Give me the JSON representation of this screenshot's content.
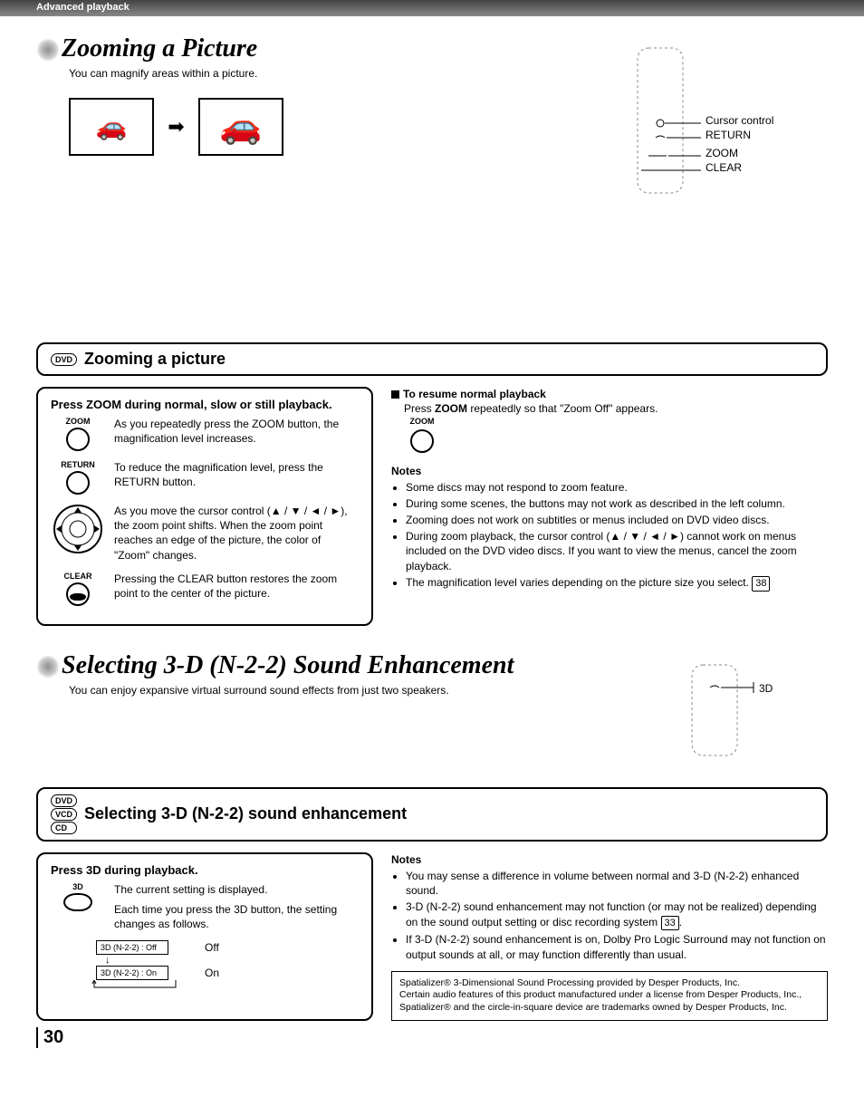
{
  "topbar": "Advanced playback",
  "zoom": {
    "title": "Zooming a Picture",
    "subtitle": "You can magnify areas within a picture.",
    "remote_labels": {
      "cursor": "Cursor control",
      "return": "RETURN",
      "zoom": "ZOOM",
      "clear": "CLEAR"
    },
    "bar_label": "Zooming a picture",
    "bar_badge": "DVD",
    "instruction_head": "Press ZOOM during normal, slow or still playback.",
    "btn_zoom": "ZOOM",
    "btn_return": "RETURN",
    "btn_clear": "CLEAR",
    "txt_zoom": "As you repeatedly press the ZOOM button, the magnification level increases.",
    "txt_return": "To reduce the magnification level, press the RETURN button.",
    "txt_cursor": "As you move the cursor control (▲ / ▼ / ◄ / ►), the zoom point shifts. When the zoom point reaches an edge of the picture, the color of \"Zoom\" changes.",
    "txt_clear": "Pressing the CLEAR button restores the zoom point to the center of the picture.",
    "resume_head": "To resume normal playback",
    "resume_body_a": "Press ",
    "resume_body_b": "ZOOM",
    "resume_body_c": " repeatedly so that \"Zoom Off\" appears.",
    "resume_btn": "ZOOM",
    "notes_head": "Notes",
    "notes": [
      "Some discs may not respond to zoom feature.",
      "During some scenes, the buttons may not work as described in the left column.",
      "Zooming does not work on subtitles or menus included on DVD video discs.",
      "During zoom playback, the cursor control (▲ / ▼ / ◄ / ►) cannot work on menus included on the DVD video discs. If you want to view the menus, cancel the zoom playback.",
      "The magnification level varies depending on the picture size you select."
    ],
    "notes_ref": "38"
  },
  "sound": {
    "title": "Selecting 3-D (N-2-2) Sound Enhancement",
    "subtitle": "You can enjoy expansive virtual surround sound effects from just two speakers.",
    "remote_label": "3D",
    "bar_label": "Selecting 3-D (N-2-2) sound enhancement",
    "bar_badges": [
      "DVD",
      "VCD",
      "CD"
    ],
    "instruction_head": "Press 3D during playback.",
    "btn_3d": "3D",
    "txt_3d_a": "The current setting is displayed.",
    "txt_3d_b": "Each time you press the 3D button, the setting changes as follows.",
    "opt_off_box": "3D (N-2-2) : Off",
    "opt_off_label": "Off",
    "opt_on_box": "3D (N-2-2) : On",
    "opt_on_label": "On",
    "notes_head": "Notes",
    "notes": [
      "You may sense a difference in volume between normal and 3-D (N-2-2) enhanced sound.",
      "3-D (N-2-2) sound enhancement may not function (or may not be realized) depending on the sound output setting or disc recording system",
      "If 3-D (N-2-2) sound enhancement is on, Dolby Pro Logic Surround may not function on output sounds at all, or may function differently than usual."
    ],
    "notes_ref": "33",
    "footer_a": "Spatializer® 3-Dimensional Sound Processing provided by Desper Products, Inc.",
    "footer_b": "Certain audio features of this product manufactured under a license from Desper Products, Inc., Spatializer® and the circle-in-square device are trademarks owned by Desper Products, Inc."
  },
  "page_number": "30"
}
